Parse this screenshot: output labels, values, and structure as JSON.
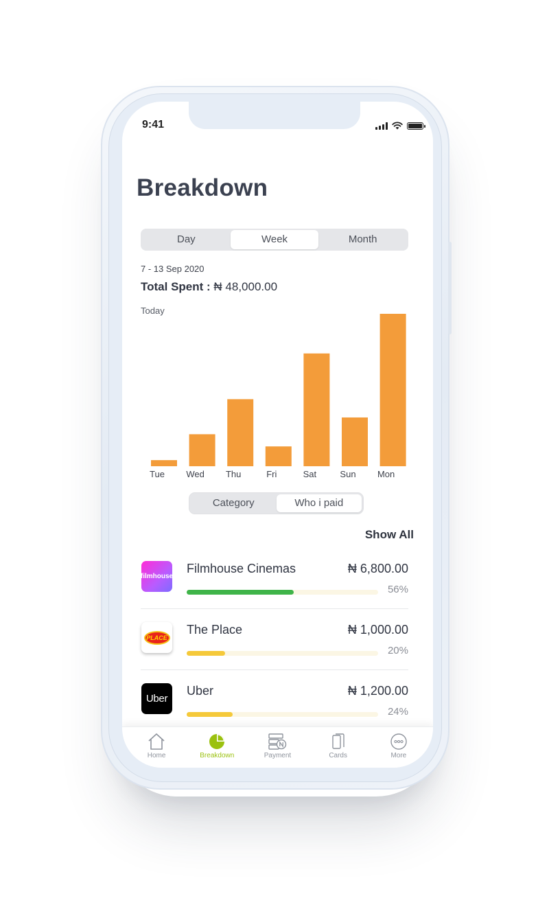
{
  "status": {
    "time": "9:41"
  },
  "page": {
    "title": "Breakdown"
  },
  "period_tabs": [
    {
      "label": "Day",
      "active": false
    },
    {
      "label": "Week",
      "active": true
    },
    {
      "label": "Month",
      "active": false
    }
  ],
  "summary": {
    "date_range": "7 - 13 Sep 2020",
    "total_label": "Total Spent :",
    "total_value": "₦ 48,000.00",
    "today_label": "Today"
  },
  "chart_data": {
    "type": "bar",
    "categories": [
      "Tue",
      "Wed",
      "Thu",
      "Fri",
      "Sat",
      "Sun",
      "Mon"
    ],
    "values": [
      4,
      21,
      44,
      13,
      74,
      32,
      100
    ],
    "title": "",
    "xlabel": "",
    "ylabel": "",
    "ylim": [
      0,
      100
    ],
    "grid": false,
    "bar_color": "#f39c3a"
  },
  "view_tabs": [
    {
      "label": "Category",
      "active": false
    },
    {
      "label": "Who i paid",
      "active": true
    }
  ],
  "show_all_label": "Show All",
  "merchants": [
    {
      "name": "Filmhouse Cinemas",
      "amount": "₦ 6,800.00",
      "percent": "56%",
      "fraction": 0.56,
      "bar_color": "#3fb449",
      "logo_text": "filmhouse"
    },
    {
      "name": "The Place",
      "amount": "₦ 1,000.00",
      "percent": "20%",
      "fraction": 0.2,
      "bar_color": "#f5c93a",
      "logo_text": "PLACE"
    },
    {
      "name": "Uber",
      "amount": "₦ 1,200.00",
      "percent": "24%",
      "fraction": 0.24,
      "bar_color": "#f5c93a",
      "logo_text": "Uber"
    }
  ],
  "tabbar": [
    {
      "label": "Home",
      "icon": "home-icon",
      "active": false
    },
    {
      "label": "Breakdown",
      "icon": "pie-chart-icon",
      "active": true
    },
    {
      "label": "Payment",
      "icon": "payment-icon",
      "active": false
    },
    {
      "label": "Cards",
      "icon": "cards-icon",
      "active": false
    },
    {
      "label": "More",
      "icon": "more-icon",
      "active": false
    }
  ],
  "colors": {
    "accent": "#9bc10f",
    "bar": "#f39c3a",
    "green": "#3fb449",
    "yellow": "#f5c93a"
  }
}
